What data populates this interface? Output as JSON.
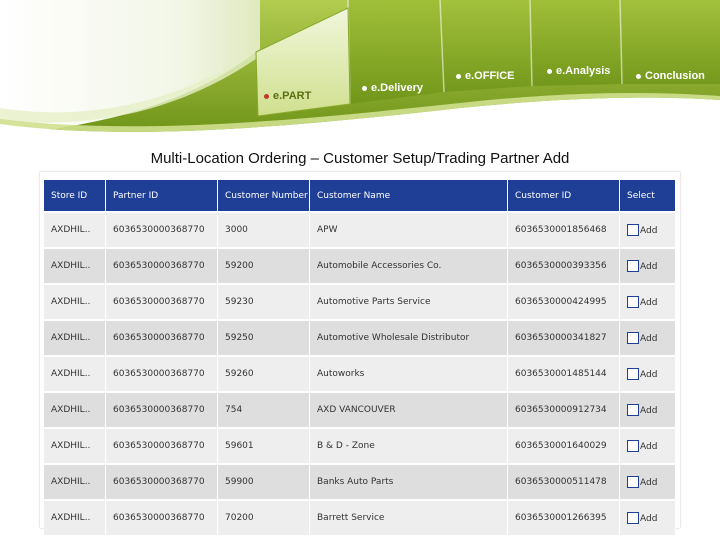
{
  "nav": {
    "tabs": [
      {
        "label": "e.PART",
        "active": true
      },
      {
        "label": "e.Delivery",
        "active": false
      },
      {
        "label": "e.OFFICE",
        "active": false
      },
      {
        "label": "e.Analysis",
        "active": false
      },
      {
        "label": "Conclusion",
        "active": false
      }
    ]
  },
  "page": {
    "title": "Multi-Location Ordering – Customer Setup/Trading Partner Add"
  },
  "table": {
    "headers": [
      "Store ID",
      "Partner ID",
      "Customer Number",
      "Customer Name",
      "Customer ID",
      "Select"
    ],
    "rows": [
      {
        "store_id": "AXDHIL..",
        "partner_id": "6036530000368770",
        "customer_number": "3000",
        "customer_name": "APW",
        "customer_id": "6036530001856468",
        "select": "Add"
      },
      {
        "store_id": "AXDHIL..",
        "partner_id": "6036530000368770",
        "customer_number": "59200",
        "customer_name": "Automobile Accessories Co.",
        "customer_id": "6036530000393356",
        "select": "Add"
      },
      {
        "store_id": "AXDHIL..",
        "partner_id": "6036530000368770",
        "customer_number": "59230",
        "customer_name": "Automotive Parts Service",
        "customer_id": "6036530000424995",
        "select": "Add"
      },
      {
        "store_id": "AXDHIL..",
        "partner_id": "6036530000368770",
        "customer_number": "59250",
        "customer_name": "Automotive Wholesale Distributor",
        "customer_id": "6036530000341827",
        "select": "Add"
      },
      {
        "store_id": "AXDHIL..",
        "partner_id": "6036530000368770",
        "customer_number": "59260",
        "customer_name": "Autoworks",
        "customer_id": "6036530001485144",
        "select": "Add"
      },
      {
        "store_id": "AXDHIL..",
        "partner_id": "6036530000368770",
        "customer_number": "754",
        "customer_name": "AXD VANCOUVER",
        "customer_id": "6036530000912734",
        "select": "Add"
      },
      {
        "store_id": "AXDHIL..",
        "partner_id": "6036530000368770",
        "customer_number": "59601",
        "customer_name": "B & D - Zone",
        "customer_id": "6036530001640029",
        "select": "Add"
      },
      {
        "store_id": "AXDHIL..",
        "partner_id": "6036530000368770",
        "customer_number": "59900",
        "customer_name": "Banks Auto Parts",
        "customer_id": "6036530000511478",
        "select": "Add"
      },
      {
        "store_id": "AXDHIL..",
        "partner_id": "6036530000368770",
        "customer_number": "70200",
        "customer_name": "Barrett Service",
        "customer_id": "6036530001266395",
        "select": "Add"
      }
    ]
  },
  "colors": {
    "banner_green": "#8cae2a",
    "banner_dark_green": "#5f7f12",
    "header_blue": "#1f3f96",
    "row_light": "#eeeeee",
    "row_dark": "#dedede"
  }
}
